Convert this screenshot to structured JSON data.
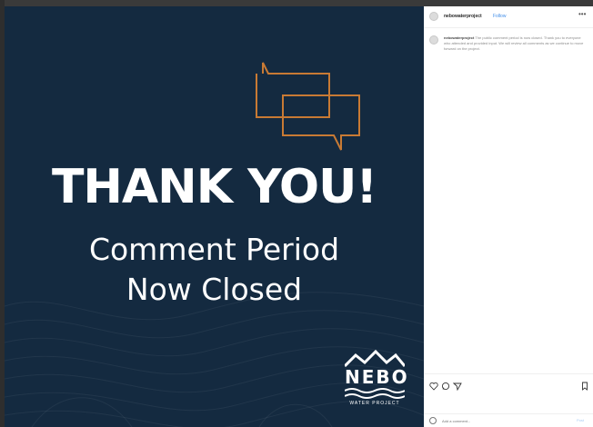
{
  "post": {
    "headline": "THANK YOU!",
    "subline_1": "Comment Period",
    "subline_2": "Now Closed",
    "logo": {
      "word": "NEBO",
      "tagline": "WATER PROJECT",
      "icon": "mountain-waves-logo"
    },
    "icon": "speech-bubbles-icon",
    "colors": {
      "background": "#142a40",
      "accent": "#c87a34",
      "text": "#ffffff"
    }
  },
  "sidebar": {
    "username": "nebowaterproject",
    "follow_label": "Follow",
    "more_icon": "more-dots-icon",
    "caption": {
      "username": "nebowaterproject",
      "text": "The public comment period is now closed. Thank you to everyone who attended and provided input. We will review all comments as we continue to move forward on the project."
    },
    "action_icons": [
      "heart-icon",
      "comment-icon",
      "share-icon",
      "bookmark-icon"
    ],
    "comment_placeholder": "Add a comment...",
    "post_label": "Post",
    "emoji_icon": "emoji-icon"
  }
}
